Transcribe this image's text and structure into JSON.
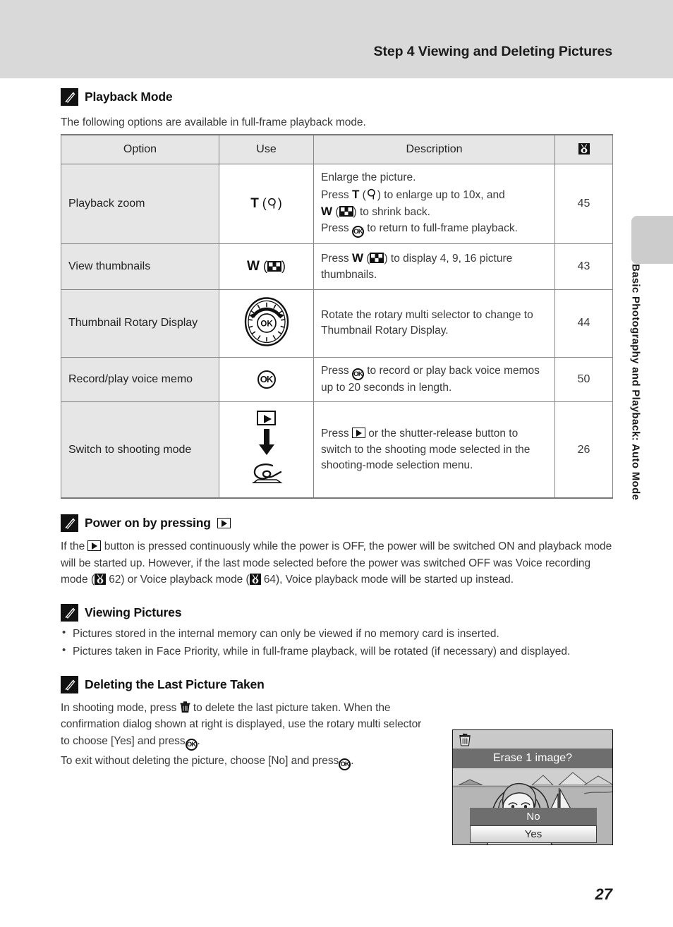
{
  "header": {
    "title": "Step 4 Viewing and Deleting Pictures"
  },
  "sidebar": {
    "label": "Basic Photography and Playback: Auto Mode"
  },
  "page_number": "27",
  "sections": {
    "playback_mode": {
      "icon": "pencil-note-icon",
      "heading": "Playback Mode",
      "intro": "The following options are available in full-frame playback mode."
    },
    "power_on": {
      "icon": "pencil-note-icon",
      "heading_prefix": "Power on by pressing",
      "paragraph_1": "If the",
      "paragraph_2": "button is pressed continuously while the power is OFF, the power will be switched ON and playback mode will be started up. However, if the last mode selected before the power was switched OFF was Voice recording mode (",
      "ref_1": "62",
      "paragraph_3": ") or Voice playback mode (",
      "ref_2": "64",
      "paragraph_4": "), Voice playback mode will be started up instead."
    },
    "viewing_pictures": {
      "icon": "pencil-note-icon",
      "heading": "Viewing Pictures",
      "bullets": [
        "Pictures stored in the internal memory can only be viewed if no memory card is inserted.",
        "Pictures taken in Face Priority, while in full-frame playback, will be rotated (if necessary) and displayed."
      ]
    },
    "deleting_last": {
      "icon": "pencil-note-icon",
      "heading": "Deleting the Last Picture Taken",
      "para1_a": "In shooting mode, press",
      "para1_b": "to delete the last picture taken. When the confirmation dialog shown at right is displayed, use the rotary multi selector to choose [Yes] and press",
      "para1_c": ".",
      "para2_a": "To exit without deleting the picture, choose [No] and press",
      "para2_b": "."
    }
  },
  "table": {
    "headers": {
      "option": "Option",
      "use": "Use",
      "description": "Description",
      "page_ref_icon": "page-reference-icon"
    },
    "rows": [
      {
        "option": "Playback zoom",
        "use_label": "T",
        "use_icon": "magnifier-icon",
        "desc_line1": "Enlarge the picture.",
        "desc_line2_a": "Press",
        "desc_line2_key": "T",
        "desc_line2_b": "to enlarge up to 10x, and",
        "desc_line3_key": "W",
        "desc_line3_b": "to shrink back.",
        "desc_line4_a": "Press",
        "desc_line4_b": "to return to full-frame playback.",
        "page": "45"
      },
      {
        "option": "View thumbnails",
        "use_label": "W",
        "use_icon": "thumbnail-grid-icon",
        "desc_a": "Press",
        "desc_key": "W",
        "desc_b": "to display 4, 9, 16 picture thumbnails.",
        "page": "43"
      },
      {
        "option": "Thumbnail Rotary Display",
        "use_icon": "rotary-multi-selector-icon",
        "use_icon_label": "OK",
        "desc": "Rotate the rotary multi selector to change to Thumbnail Rotary Display.",
        "page": "44"
      },
      {
        "option": "Record/play voice memo",
        "use_icon": "ok-button-icon",
        "desc_a": "Press",
        "desc_b": "to record or play back voice memos up to 20 seconds in length.",
        "page": "50"
      },
      {
        "option": "Switch to shooting mode",
        "use_icon_1": "play-button-icon",
        "use_icon_2": "down-arrow-icon",
        "use_icon_3": "camera-shooting-icon",
        "desc_a": "Press",
        "desc_b": "or the shutter-release button to switch to the shooting mode selected in the shooting-mode selection menu.",
        "page": "26"
      }
    ]
  },
  "lcd": {
    "trash_icon": "trash-can-icon",
    "banner": "Erase 1 image?",
    "option_no": "No",
    "option_yes": "Yes"
  },
  "colors": {
    "header_band": "#d9d9d9",
    "side_tab": "#cccccc",
    "table_header_bg": "#e6e6e6",
    "table_option_bg": "#e6e6e6",
    "lcd_banner": "#6e6e6e"
  }
}
